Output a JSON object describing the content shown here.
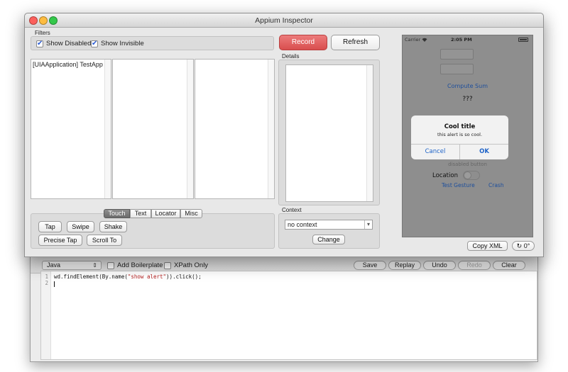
{
  "window": {
    "title": "Appium Inspector"
  },
  "filters": {
    "label": "Filters",
    "show_disabled": {
      "label": "Show Disabled",
      "checked": true
    },
    "show_invisible": {
      "label": "Show Invisible",
      "checked": true
    }
  },
  "buttons": {
    "record": "Record",
    "refresh": "Refresh",
    "copy_xml": "Copy XML",
    "change": "Change"
  },
  "rotation": {
    "icon": "rotate-icon",
    "value": "0°"
  },
  "tree": {
    "column1": [
      "[UIAApplication] TestApp"
    ],
    "arrow": "▸"
  },
  "details": {
    "label": "Details"
  },
  "context": {
    "label": "Context",
    "selected": "no context",
    "arrow": "▾"
  },
  "actions": {
    "tabs": [
      "Touch",
      "Text",
      "Locator",
      "Misc"
    ],
    "selected_tab": "Touch",
    "tap": "Tap",
    "swipe": "Swipe",
    "shake": "Shake",
    "precise_tap": "Precise Tap",
    "scroll_to": "Scroll To"
  },
  "phone": {
    "carrier": "Carrier",
    "wifi_icon": "wifi-icon",
    "time": "2:05 PM",
    "battery_icon": "battery-icon",
    "compute_sum": "Compute Sum",
    "answer": "???",
    "alert": {
      "title": "Cool title",
      "message": "this alert is so cool.",
      "cancel": "Cancel",
      "ok": "OK"
    },
    "disabled_button": "disabled button",
    "location": "Location",
    "test_gesture": "Test Gesture",
    "crash": "Crash"
  },
  "recorder": {
    "language": "Java",
    "language_arrow": "⇕",
    "add_boilerplate": {
      "label": "Add Boilerplate",
      "checked": false
    },
    "xpath_only": {
      "label": "XPath Only",
      "checked": false
    },
    "save": "Save",
    "replay": "Replay",
    "undo": "Undo",
    "redo": "Redo",
    "clear": "Clear",
    "line_numbers": [
      "1",
      "2"
    ],
    "code": {
      "prefix": "wd.findElement(By.name(",
      "string": "\"show alert\"",
      "suffix": ")).click();"
    }
  },
  "colors": {
    "record": "#e05d5d",
    "ios_blue": "#1e63c8",
    "close_light": "#fc605c",
    "min_light": "#fdbc40",
    "max_light": "#34c84a"
  }
}
